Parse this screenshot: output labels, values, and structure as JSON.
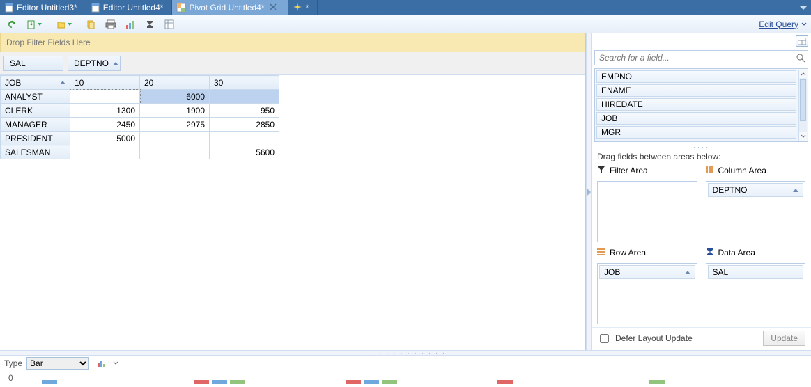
{
  "colors": {
    "accent": "#3b6ea5",
    "tab_active": "#7aa7d6",
    "border": "#b9cee6",
    "filter_bg": "#f8e9b2"
  },
  "tabs": [
    {
      "label": "Editor Untitled3*",
      "active": false,
      "icon": "editor"
    },
    {
      "label": "Editor Untitled4*",
      "active": false,
      "icon": "editor"
    },
    {
      "label": "Pivot Grid Untitled4*",
      "active": true,
      "icon": "pivot"
    },
    {
      "label": "*",
      "active": false,
      "icon": "sparkle"
    }
  ],
  "toolbar": {
    "edit_query": "Edit Query"
  },
  "filter_drop_text": "Drop Filter Fields Here",
  "pivot": {
    "data_field": "SAL",
    "col_field": "DEPTNO",
    "row_field": "JOB",
    "columns": [
      "10",
      "20",
      "30"
    ],
    "rows": [
      {
        "label": "ANALYST",
        "values": [
          "",
          "6000",
          ""
        ],
        "selected": true
      },
      {
        "label": "CLERK",
        "values": [
          "1300",
          "1900",
          "950"
        ]
      },
      {
        "label": "MANAGER",
        "values": [
          "2450",
          "2975",
          "2850"
        ]
      },
      {
        "label": "PRESIDENT",
        "values": [
          "5000",
          "",
          ""
        ]
      },
      {
        "label": "SALESMAN",
        "values": [
          "",
          "",
          "5600"
        ]
      }
    ]
  },
  "field_panel": {
    "search_placeholder": "Search for a field...",
    "fields": [
      "EMPNO",
      "ENAME",
      "HIREDATE",
      "JOB",
      "MGR"
    ],
    "instruction": "Drag fields between areas below:",
    "areas": {
      "filter": {
        "title": "Filter Area",
        "chips": []
      },
      "column": {
        "title": "Column Area",
        "chips": [
          "DEPTNO"
        ]
      },
      "row": {
        "title": "Row Area",
        "chips": [
          "JOB"
        ]
      },
      "data": {
        "title": "Data Area",
        "chips": [
          "SAL"
        ]
      }
    },
    "defer_label": "Defer Layout Update",
    "defer_checked": false,
    "update_label": "Update"
  },
  "chartbar": {
    "type_label": "Type",
    "type_value": "Bar"
  },
  "chart": {
    "zero_label": "0"
  },
  "chart_data": {
    "type": "bar",
    "title": "",
    "xlabel": "",
    "ylabel": "",
    "ylim": [
      0,
      6000
    ],
    "categories": [
      "ANALYST",
      "CLERK",
      "MANAGER",
      "PRESIDENT",
      "SALESMAN"
    ],
    "series": [
      {
        "name": "10",
        "values": [
          null,
          1300,
          2450,
          5000,
          null
        ]
      },
      {
        "name": "20",
        "values": [
          6000,
          1900,
          2975,
          null,
          null
        ]
      },
      {
        "name": "30",
        "values": [
          null,
          950,
          2850,
          null,
          5600
        ]
      }
    ]
  }
}
